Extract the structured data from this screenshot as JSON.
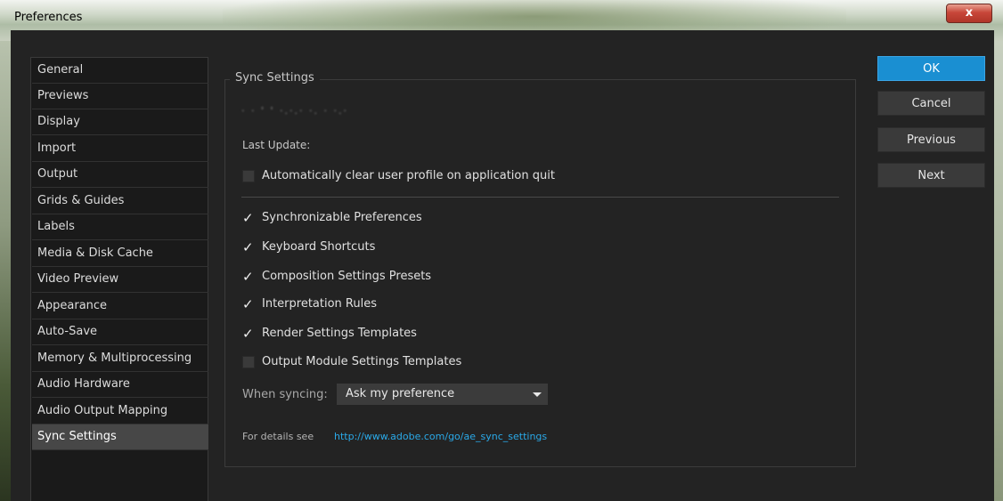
{
  "window": {
    "title": "Preferences",
    "close_label": "x"
  },
  "sidebar": {
    "items": [
      {
        "label": "General"
      },
      {
        "label": "Previews"
      },
      {
        "label": "Display"
      },
      {
        "label": "Import"
      },
      {
        "label": "Output"
      },
      {
        "label": "Grids & Guides"
      },
      {
        "label": "Labels"
      },
      {
        "label": "Media & Disk Cache"
      },
      {
        "label": "Video Preview"
      },
      {
        "label": "Appearance"
      },
      {
        "label": "Auto-Save"
      },
      {
        "label": "Memory & Multiprocessing"
      },
      {
        "label": "Audio Hardware"
      },
      {
        "label": "Audio Output Mapping"
      },
      {
        "label": "Sync Settings",
        "selected": true
      }
    ]
  },
  "sync": {
    "group_title": "Sync Settings",
    "account_text": "· · ' ' ·.·.· ·. · ·.·",
    "last_update_label": "Last Update:",
    "auto_clear": {
      "label": "Automatically clear user profile on application quit",
      "checked": false
    },
    "items": [
      {
        "label": "Synchronizable Preferences",
        "checked": true
      },
      {
        "label": "Keyboard Shortcuts",
        "checked": true
      },
      {
        "label": "Composition Settings Presets",
        "checked": true
      },
      {
        "label": "Interpretation Rules",
        "checked": true
      },
      {
        "label": "Render Settings Templates",
        "checked": true
      },
      {
        "label": "Output Module Settings Templates",
        "checked": false
      }
    ],
    "when_syncing_label": "When syncing:",
    "when_syncing_value": "Ask my preference",
    "details_label": "For details see",
    "details_link": "http://www.adobe.com/go/ae_sync_settings"
  },
  "buttons": {
    "ok": "OK",
    "cancel": "Cancel",
    "previous": "Previous",
    "next": "Next"
  },
  "colors": {
    "accent": "#1a8fd2",
    "link": "#2aa9e8",
    "selected_item": "#474747"
  },
  "icons": {
    "check": "✓"
  }
}
